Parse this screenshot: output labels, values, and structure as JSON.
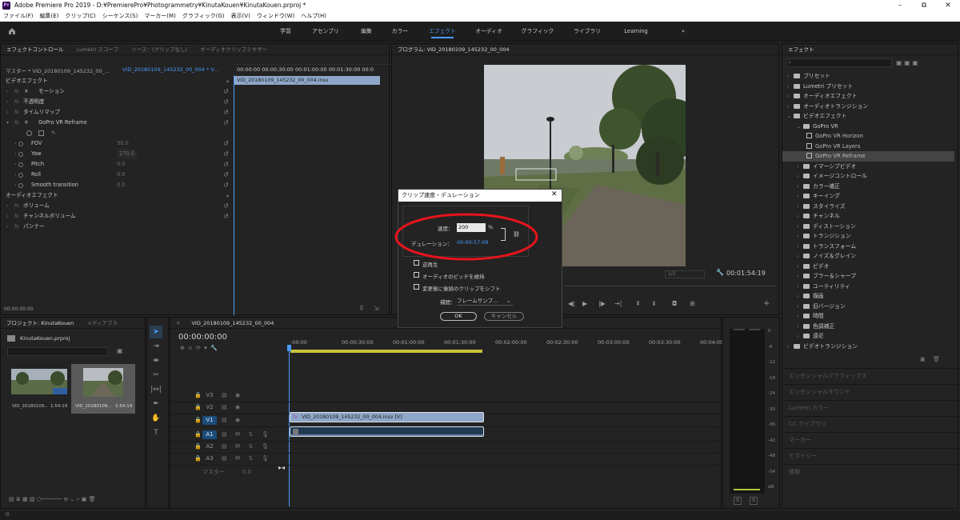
{
  "window": {
    "title": "Adobe Premiere Pro 2019 - D:¥PremierePro¥Photogrammetry¥KinutaKouen¥KinutaKouen.prproj *",
    "app_logo": "Pr",
    "min": "–",
    "max": "⧉",
    "close": "✕"
  },
  "menu": [
    "ファイル(F)",
    "編集(E)",
    "クリップ(C)",
    "シーケンス(S)",
    "マーカー(M)",
    "グラフィック(G)",
    "表示(V)",
    "ウィンドウ(W)",
    "ヘルプ(H)"
  ],
  "workspaces": [
    "学習",
    "アセンブリ",
    "編集",
    "カラー",
    "エフェクト",
    "オーディオ",
    "グラフィック",
    "ライブラリ",
    "Learning"
  ],
  "workspace_more": "»",
  "effect_controls": {
    "tabs": [
      "エフェクトコントロール",
      "Lumetri スコープ",
      "ソース：(クリップなし)",
      "オーディオクリップミキサー"
    ],
    "master": "マスター * VID_20180109_145232_00_...",
    "sequence": "VID_20180109_145232_00_004 * V...",
    "timecodes": "00:00:00   00:00:30:00   00:01:00:00   00:01:30:00   00:0",
    "clip_label": "VID_20180109_145232_00_004.insv",
    "video_header": "ビデオエフェクト",
    "audio_header": "オーディオエフェクト",
    "video_items": [
      "モーション",
      "不透明度",
      "タイムリマップ",
      "GoPro VR Reframe"
    ],
    "params": [
      {
        "name": "FOV",
        "value": "30.0"
      },
      {
        "name": "Yaw",
        "value": "270.0"
      },
      {
        "name": "Pitch",
        "value": "0.0"
      },
      {
        "name": "Roll",
        "value": "0.0"
      },
      {
        "name": "Smooth transition",
        "value": "0.0"
      }
    ],
    "audio_items": [
      "ボリューム",
      "チャンネルボリューム",
      "パンナー"
    ],
    "footer_time": "00:00:00:00"
  },
  "program": {
    "tab": "プログラム: VID_20180109_145232_00_004",
    "fit": "1/2",
    "timecode": "00:01:54:19"
  },
  "dialog": {
    "title": "クリップ速度・デュレーション",
    "speed_label": "速度：",
    "speed_value": "200",
    "percent": "%",
    "duration_label": "デュレーション：",
    "duration_value": "00:00:57:09",
    "reverse": "逆再生",
    "pitch": "オーディオのピッチを維持",
    "ripple": "変更後に後続のクリップをシフト",
    "interp_label": "補間：",
    "interp_value": "フレームサンプ...",
    "ok": "OK",
    "cancel": "キャンセル",
    "highlight_color": "#e8141c"
  },
  "project": {
    "tabs": [
      "プロジェクト: KinutaKouen",
      "メディアブラ"
    ],
    "file": "KinutaKouen.prproj",
    "items": [
      {
        "name": "VID_20180109...",
        "duration": "1:54:19"
      },
      {
        "name": "VID_20180109...",
        "duration": "1:54:19"
      }
    ]
  },
  "timeline": {
    "tab": "VID_20180109_145232_00_004",
    "timecode": "00:00:00:00",
    "ruler": [
      ":00:00",
      "00:00:30:00",
      "00:01:00:00",
      "00:01:30:00",
      "00:02:00:00",
      "00:02:30:00",
      "00:03:00:00",
      "00:03:30:00",
      "00:04:00:0"
    ],
    "tracks": [
      "V3",
      "V2",
      "V1",
      "A1",
      "A2",
      "A3"
    ],
    "master": "マスター",
    "master_val": "0.0",
    "clip_label": "VID_20180109_145232_00_004.insv [V]",
    "accent": "#4a9bff"
  },
  "meters": {
    "ticks": [
      "0",
      "-6",
      "-12",
      "-18",
      "-24",
      "-30",
      "-36",
      "-42",
      "-48",
      "-54",
      "dB"
    ],
    "solo": "S"
  },
  "effects": {
    "tab": "エフェクト",
    "tree": [
      {
        "label": "プリセット",
        "level": 0,
        "type": "folder"
      },
      {
        "label": "Lumetri プリセット",
        "level": 0,
        "type": "folder"
      },
      {
        "label": "オーディオエフェクト",
        "level": 0,
        "type": "folder"
      },
      {
        "label": "オーディオトランジション",
        "level": 0,
        "type": "folder"
      },
      {
        "label": "ビデオエフェクト",
        "level": 0,
        "type": "folder",
        "open": true
      },
      {
        "label": "GoPro VR",
        "level": 1,
        "type": "folder",
        "open": true
      },
      {
        "label": "GoPro VR Horizon",
        "level": 2,
        "type": "preset"
      },
      {
        "label": "GoPro VR Layers",
        "level": 2,
        "type": "preset"
      },
      {
        "label": "GoPro VR Reframe",
        "level": 2,
        "type": "preset",
        "selected": true
      },
      {
        "label": "イマーシブビデオ",
        "level": 1,
        "type": "folder"
      },
      {
        "label": "イメージコントロール",
        "level": 1,
        "type": "folder"
      },
      {
        "label": "カラー補正",
        "level": 1,
        "type": "folder"
      },
      {
        "label": "キーイング",
        "level": 1,
        "type": "folder"
      },
      {
        "label": "スタイライズ",
        "level": 1,
        "type": "folder"
      },
      {
        "label": "チャンネル",
        "level": 1,
        "type": "folder"
      },
      {
        "label": "ディストーション",
        "level": 1,
        "type": "folder"
      },
      {
        "label": "トランジション",
        "level": 1,
        "type": "folder"
      },
      {
        "label": "トランスフォーム",
        "level": 1,
        "type": "folder"
      },
      {
        "label": "ノイズ＆グレイン",
        "level": 1,
        "type": "folder"
      },
      {
        "label": "ビデオ",
        "level": 1,
        "type": "folder"
      },
      {
        "label": "ブラー＆シャープ",
        "level": 1,
        "type": "folder"
      },
      {
        "label": "ユーティリティ",
        "level": 1,
        "type": "folder"
      },
      {
        "label": "描画",
        "level": 1,
        "type": "folder"
      },
      {
        "label": "旧バージョン",
        "level": 1,
        "type": "folder"
      },
      {
        "label": "時間",
        "level": 1,
        "type": "folder"
      },
      {
        "label": "色調補正",
        "level": 1,
        "type": "folder"
      },
      {
        "label": "遠近",
        "level": 1,
        "type": "folder"
      },
      {
        "label": "ビデオトランジション",
        "level": 0,
        "type": "folder"
      }
    ],
    "collapsed": [
      "エッセンシャルグラフィックス",
      "エッセンシャルサウンド",
      "Lumetri カラー",
      "CC ライブラリ",
      "マーカー",
      "ヒストリー",
      "情報"
    ]
  }
}
